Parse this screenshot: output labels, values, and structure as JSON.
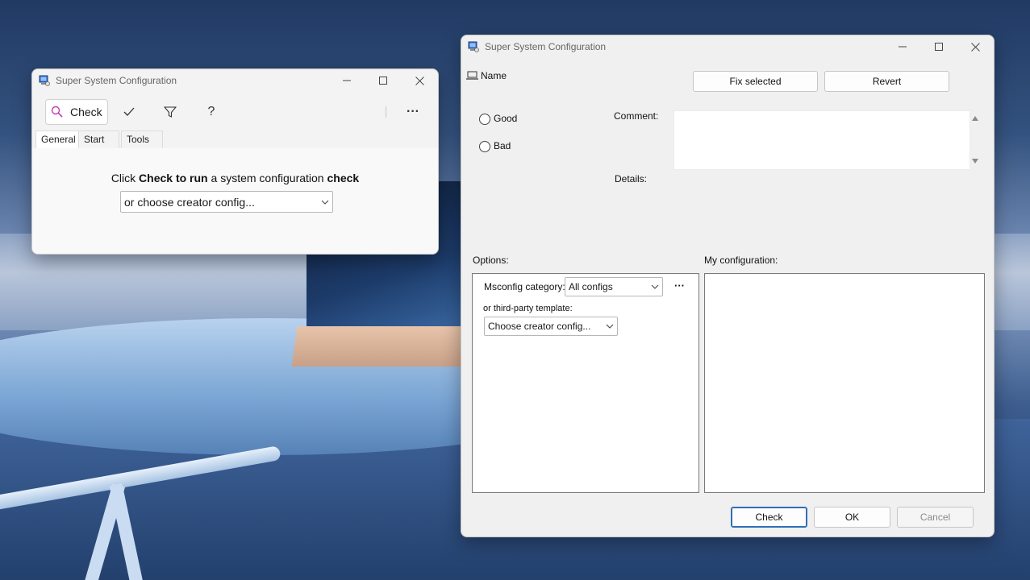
{
  "small_window": {
    "title": "Super System Configuration",
    "toolbar": {
      "check_label": "Check",
      "check_icon": "magnifier-icon",
      "accept_icon": "checkmark-icon",
      "filter_icon": "filter-icon",
      "help_label": "?",
      "more_label": "···"
    },
    "tabs": [
      {
        "label": "General",
        "active": true
      },
      {
        "label": "Start",
        "active": false
      },
      {
        "label": "Tools",
        "active": false
      }
    ],
    "instruction": {
      "part1": "Click ",
      "bold1": "Check to run",
      "part2": " a system configuration ",
      "bold2": "check"
    },
    "creator_select": {
      "value": "or choose creator config..."
    }
  },
  "big_window": {
    "title": "Super System Configuration",
    "name_label": "Name",
    "fix_selected_label": "Fix selected",
    "revert_label": "Revert",
    "good_label": "Good",
    "bad_label": "Bad",
    "comment_label": "Comment:",
    "details_label": "Details:",
    "options_label": "Options:",
    "my_configuration_label": "My configuration:",
    "msconfig_category_label": "Msconfig category:",
    "msconfig_category_value": "All configs",
    "more_label": "···",
    "third_party_label": "or third-party template:",
    "template_value": "Choose creator config...",
    "check_button": "Check",
    "ok_button": "OK",
    "cancel_button": "Cancel"
  },
  "colors": {
    "accent": "#2f6fb5",
    "magnifier": "#c23fb4"
  }
}
